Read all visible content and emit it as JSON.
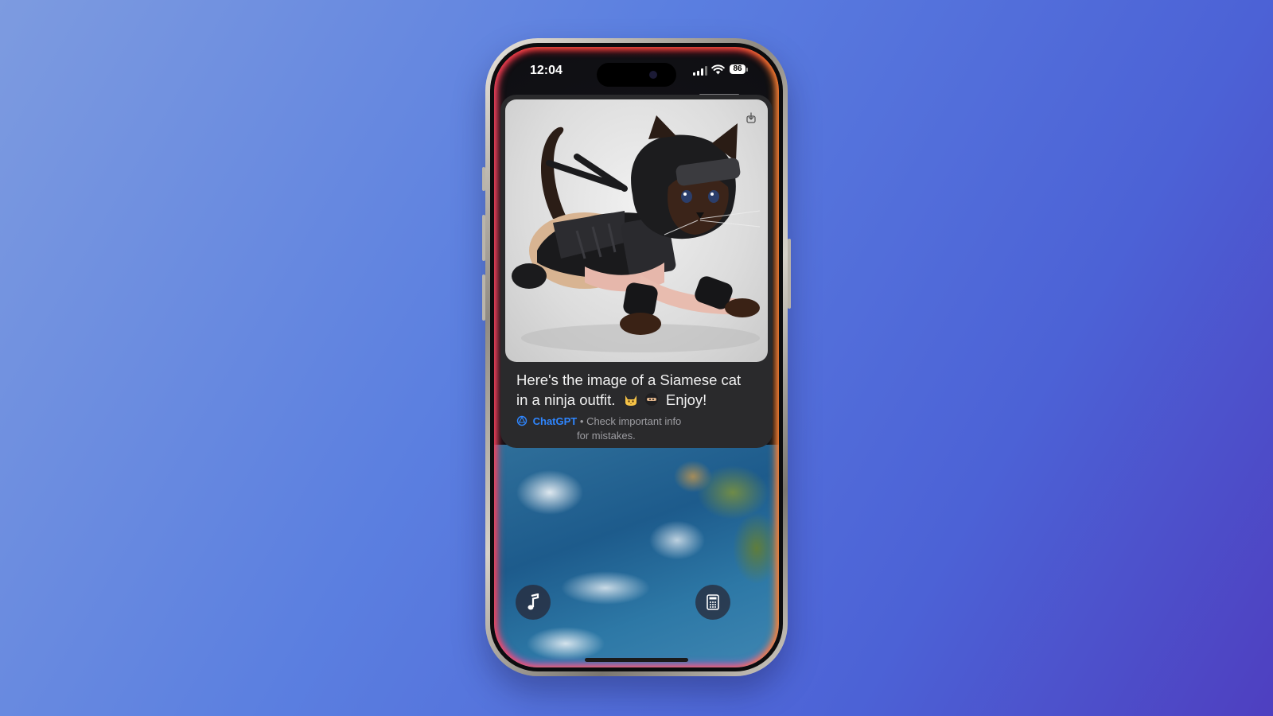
{
  "status_bar": {
    "time": "12:04",
    "battery_level": "86",
    "signal_icon": "cellular-signal-icon",
    "wifi_icon": "wifi-icon"
  },
  "notification": {
    "image_alt": "Siamese cat in a ninja outfit",
    "save_icon": "save-image-icon",
    "message_line1": "Here's the image of a Siamese cat",
    "message_line2_text": "in a ninja outfit.",
    "message_emoji_1": "cat-face-emoji",
    "message_emoji_2": "ninja-emoji",
    "message_line2_end": "Enjoy!",
    "source_name": "ChatGPT",
    "source_icon": "chatgpt-logo-icon",
    "disclaimer_part1": "Check important info",
    "disclaimer_part2": "for mistakes.",
    "separator": "•"
  },
  "lock_screen": {
    "left_shortcut_icon": "music-note-icon",
    "right_shortcut_icon": "calculator-icon",
    "wallpaper": "earth-from-space"
  },
  "colors": {
    "background_start": "#7d9be0",
    "background_end": "#4e3fc0",
    "card": "#2a2a2c",
    "brand_blue": "#2f86ff"
  }
}
